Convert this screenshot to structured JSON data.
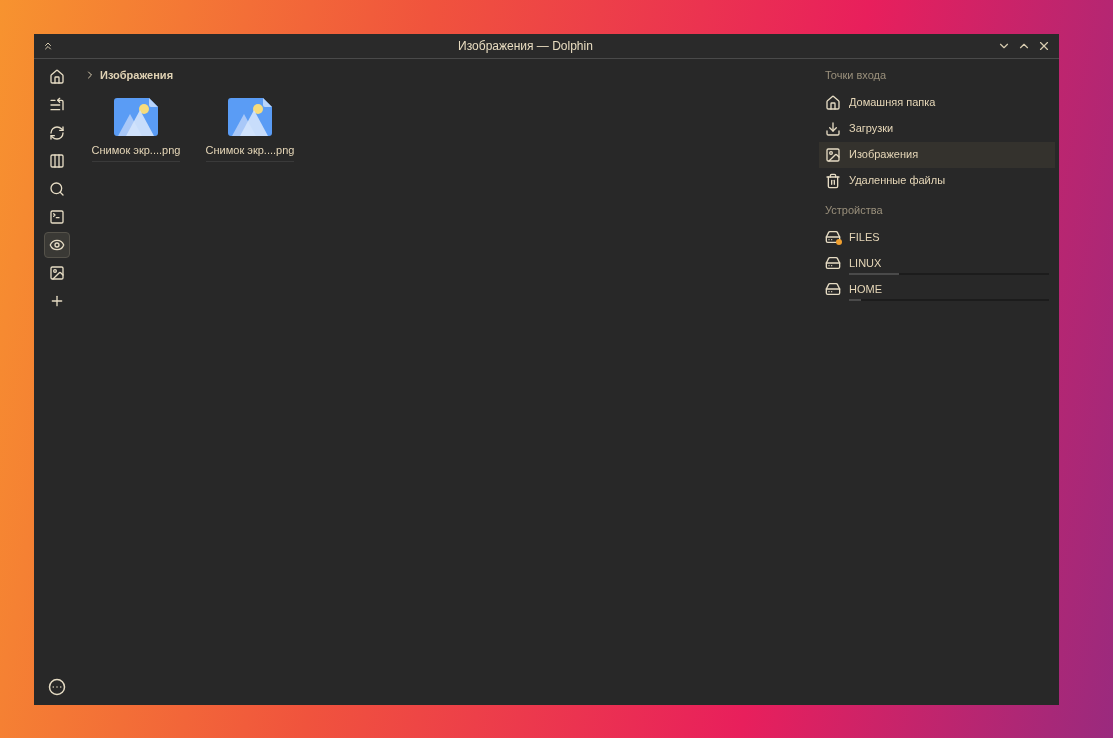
{
  "window": {
    "title": "Изображения — Dolphin"
  },
  "toolbar": [
    {
      "selected": false
    },
    {
      "selected": false
    },
    {
      "selected": false
    },
    {
      "selected": false
    },
    {
      "selected": false
    },
    {
      "selected": false
    },
    {
      "selected": true
    },
    {
      "selected": false
    },
    {
      "selected": false
    }
  ],
  "breadcrumb": {
    "current": "Изображения"
  },
  "files": [
    {
      "name": "Снимок экр....png"
    },
    {
      "name": "Снимок экр....png"
    }
  ],
  "places": {
    "sections": [
      {
        "title": "Точки входа",
        "items": [
          {
            "label": "Домашняя папка",
            "kind": "home",
            "selected": false
          },
          {
            "label": "Загрузки",
            "kind": "downloads",
            "selected": false
          },
          {
            "label": "Изображения",
            "kind": "pictures",
            "selected": true
          },
          {
            "label": "Удаленные файлы",
            "kind": "trash",
            "selected": false
          }
        ]
      },
      {
        "title": "Устройства",
        "items": [
          {
            "label": "FILES",
            "kind": "drive",
            "selected": false,
            "emblem": true
          },
          {
            "label": "LINUX",
            "kind": "drive",
            "selected": false,
            "emblem": false,
            "level": 0.25
          },
          {
            "label": "HOME",
            "kind": "drive",
            "selected": false,
            "emblem": false,
            "level": 0.06
          }
        ]
      }
    ]
  }
}
